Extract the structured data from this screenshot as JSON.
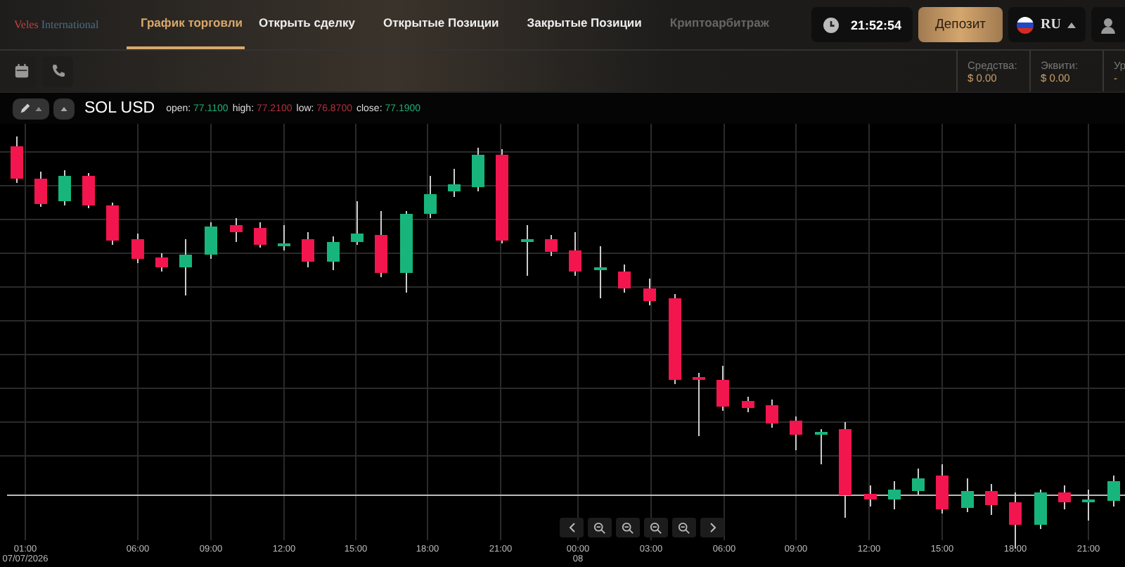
{
  "logo": {
    "first": "Veles",
    "second": "International"
  },
  "nav": [
    {
      "label": "График торговли",
      "selected": true,
      "disabled": false
    },
    {
      "label": "Открыть сделку",
      "selected": false,
      "disabled": false
    },
    {
      "label": "Открытые Позиции",
      "selected": false,
      "disabled": false
    },
    {
      "label": "Закрытые Позиции",
      "selected": false,
      "disabled": false
    },
    {
      "label": "Криптоарбитраж",
      "selected": false,
      "disabled": true
    }
  ],
  "clock": "21:52:54",
  "deposit_button": "Депозит",
  "language": "RU",
  "account": [
    {
      "label": "Средства:",
      "value": "$ 0.00"
    },
    {
      "label": "Эквити:",
      "value": "$ 0.00"
    },
    {
      "label": "Ур",
      "value": "-"
    }
  ],
  "chart": {
    "symbol": "SOL USD",
    "ohlc": [
      {
        "label": "open:",
        "value": "77.1100",
        "color": "#1fae74"
      },
      {
        "label": "high:",
        "value": "77.2100",
        "color": "#b0303f"
      },
      {
        "label": "low:",
        "value": "76.8700",
        "color": "#b0303f"
      },
      {
        "label": "close:",
        "value": "77.1900",
        "color": "#1fae74"
      }
    ],
    "x_labels": [
      {
        "time": "01:00",
        "date": "07/07/2026"
      },
      {
        "time": "06:00"
      },
      {
        "time": "09:00"
      },
      {
        "time": "12:00"
      },
      {
        "time": "15:00"
      },
      {
        "time": "18:00"
      },
      {
        "time": "21:00"
      },
      {
        "time": "00:00",
        "date": "08"
      },
      {
        "time": "03:00"
      },
      {
        "time": "06:00"
      },
      {
        "time": "09:00"
      },
      {
        "time": "12:00"
      },
      {
        "time": "15:00"
      },
      {
        "time": "18:00"
      },
      {
        "time": "21:00"
      }
    ]
  }
}
